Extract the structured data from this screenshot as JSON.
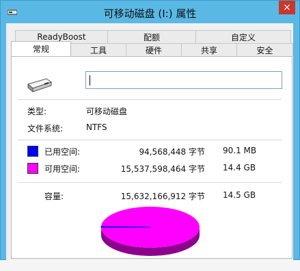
{
  "window": {
    "title": "可移动磁盘 (I:) 属性",
    "close_glyph": "×"
  },
  "tabs": {
    "row1": [
      "ReadyBoost",
      "配额",
      "自定义"
    ],
    "row2": [
      "常规",
      "工具",
      "硬件",
      "共享",
      "安全"
    ],
    "active": "常规"
  },
  "general": {
    "name_value": "",
    "type_label": "类型:",
    "type_value": "可移动磁盘",
    "fs_label": "文件系统:",
    "fs_value": "NTFS",
    "used_label": "已用空间:",
    "used_bytes": "94,568,448 字节",
    "used_size": "90.1 MB",
    "free_label": "可用空间:",
    "free_bytes": "15,537,598,464 字节",
    "free_size": "14.4 GB",
    "cap_label": "容量:",
    "cap_bytes": "15,632,166,912 字节",
    "cap_size": "14.5 GB"
  },
  "colors": {
    "used": "#0000ff",
    "free": "#ff00ff",
    "free_side": "#8c008c",
    "titlebar": "#5ab8e4"
  },
  "chart_data": {
    "type": "pie",
    "categories": [
      "已用空间",
      "可用空间"
    ],
    "values": [
      94568448,
      15537598464
    ]
  }
}
